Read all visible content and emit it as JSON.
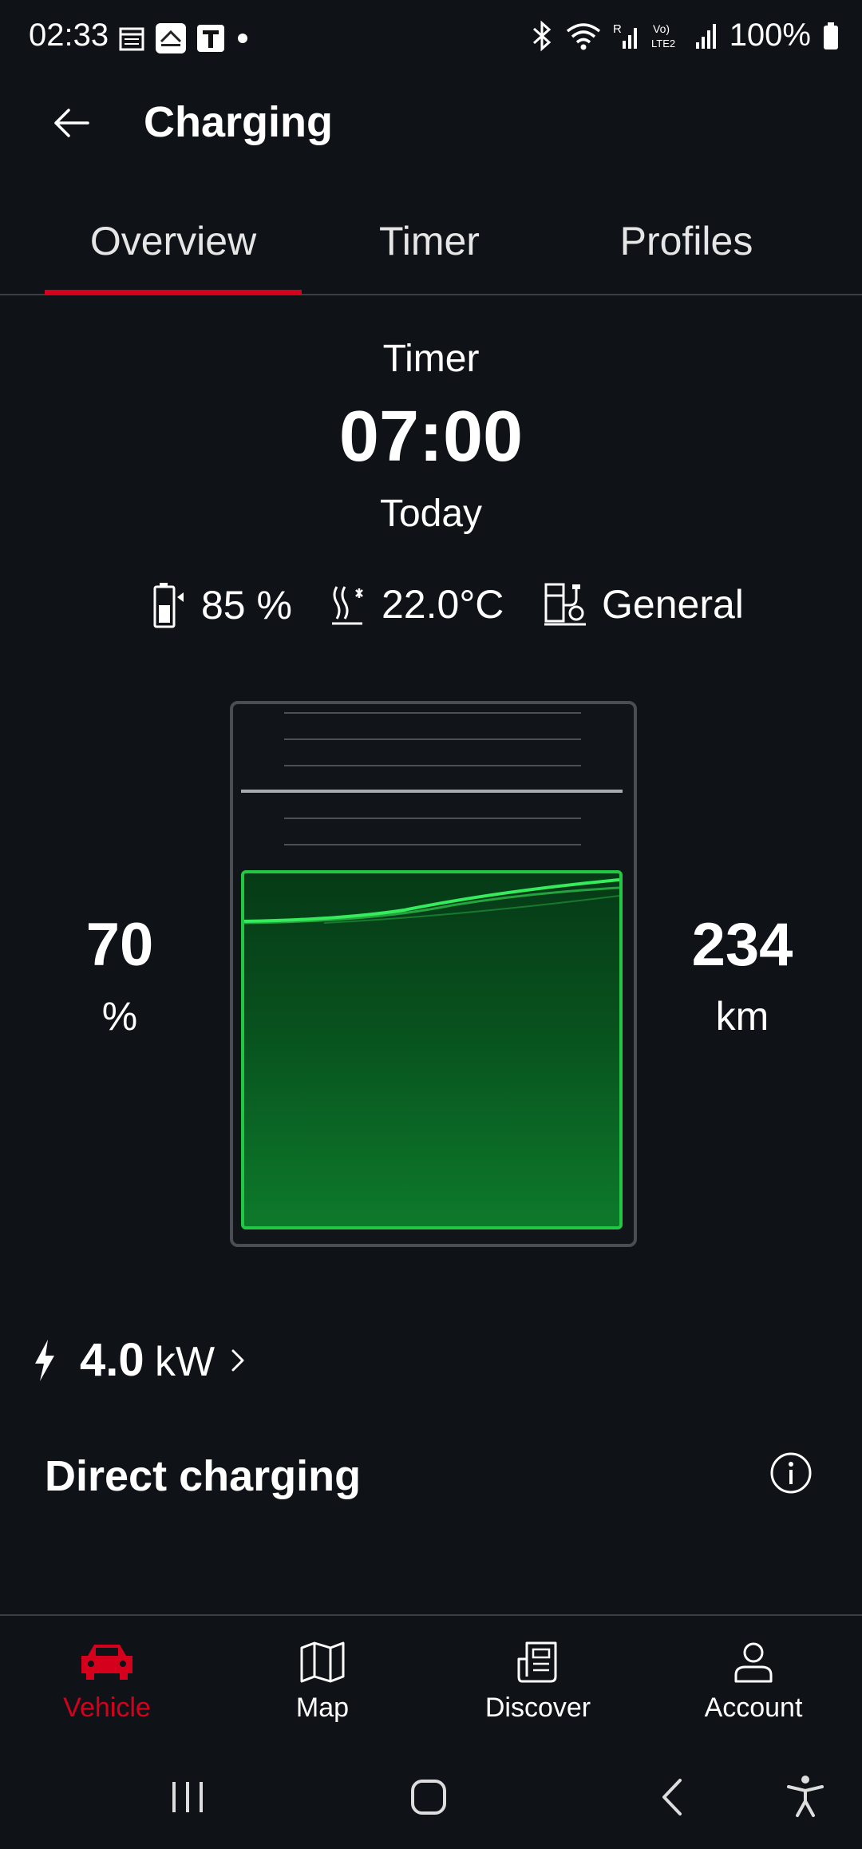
{
  "status_bar": {
    "time": "02:33",
    "battery": "100%",
    "left_icons": [
      "calendar-icon",
      "app-icon",
      "t-app-icon",
      "dot-icon"
    ],
    "right_icons": [
      "bluetooth-icon",
      "wifi-icon",
      "signal-r-icon",
      "volte-icon",
      "signal-icon",
      "battery-icon"
    ]
  },
  "header": {
    "title": "Charging"
  },
  "tabs": [
    {
      "label": "Overview",
      "active": true
    },
    {
      "label": "Timer",
      "active": false
    },
    {
      "label": "Profiles",
      "active": false
    }
  ],
  "timer": {
    "label": "Timer",
    "time": "07:00",
    "day": "Today"
  },
  "stats": {
    "target_charge": "85 %",
    "climate_temp": "22.0°C",
    "profile": "General"
  },
  "battery": {
    "level_percent": 70,
    "target_percent": 85,
    "charge_value": "70",
    "charge_unit": "%",
    "range_value": "234",
    "range_unit": "km"
  },
  "power": {
    "value": "4.0",
    "unit": "kW"
  },
  "direct_charging": {
    "title": "Direct charging"
  },
  "bottom_nav": [
    {
      "label": "Vehicle",
      "icon": "car-icon",
      "active": true
    },
    {
      "label": "Map",
      "icon": "map-icon",
      "active": false
    },
    {
      "label": "Discover",
      "icon": "discover-icon",
      "active": false
    },
    {
      "label": "Account",
      "icon": "account-icon",
      "active": false
    }
  ],
  "colors": {
    "background": "#0f1318",
    "accent": "#d5001c",
    "charge_green": "#22c744"
  }
}
